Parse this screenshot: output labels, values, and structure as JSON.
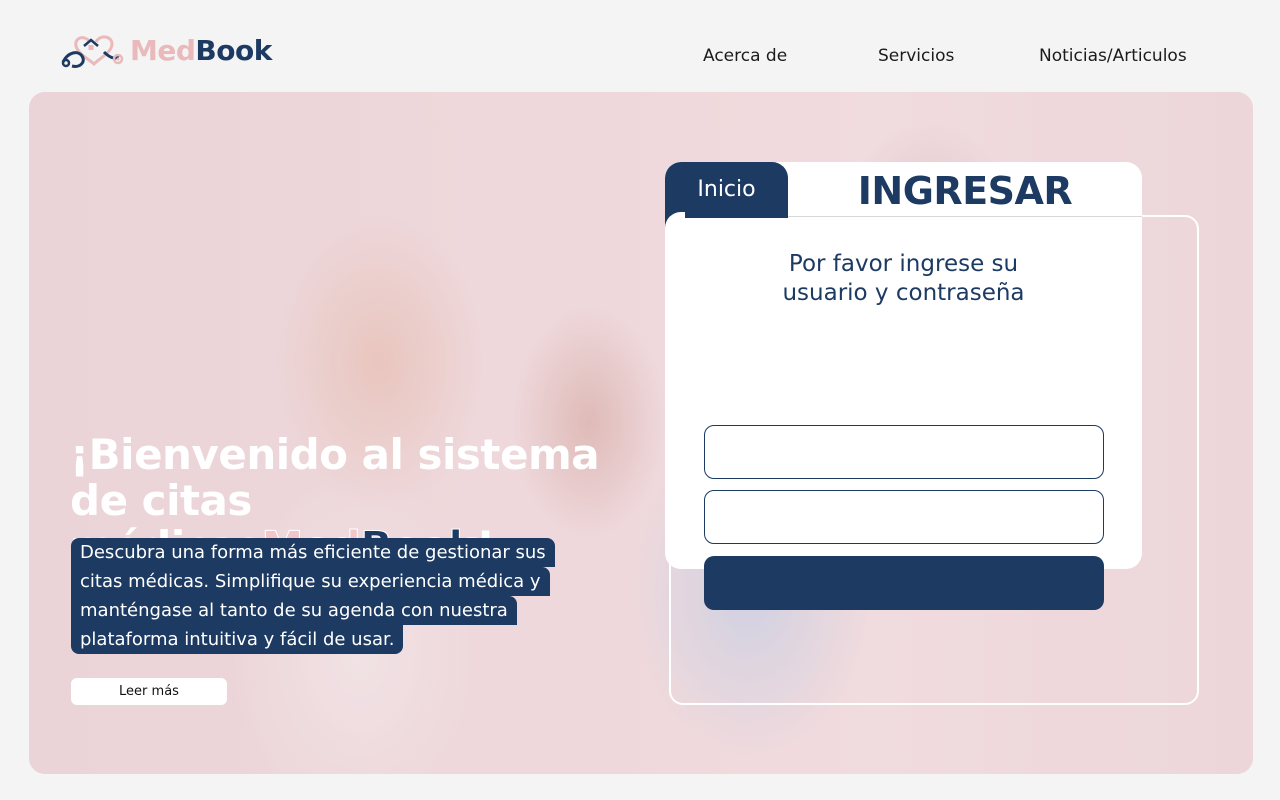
{
  "header": {
    "logo": {
      "text_med": "Med",
      "text_book": "Book",
      "icon": "stethoscope-heart-icon"
    },
    "nav": [
      {
        "label": "Acerca de"
      },
      {
        "label": "Servicios"
      },
      {
        "label": "Noticias/Articulos"
      }
    ]
  },
  "hero": {
    "title_line1": "¡Bienvenido al sistema",
    "title_line2": "de citas médicas",
    "title_brand_med": "Med",
    "title_brand_book": "Book",
    "title_end": "!",
    "description_lines": [
      "Descubra una forma más eficiente de gestionar sus",
      "citas médicas.  Simplifique su experiencia médica y",
      "manténgase al tanto de su agenda con nuestra",
      "plataforma intuitiva y fácil de usar."
    ],
    "read_more_label": "Leer más"
  },
  "login": {
    "tab_label": "Inicio",
    "title": "INGRESAR",
    "instructions_line1": "Por favor ingrese su",
    "instructions_line2": "usuario y contraseña",
    "username_value": "",
    "password_value": "",
    "submit_label": ""
  },
  "colors": {
    "brand_navy": "#1d3a63",
    "brand_pink": "#e9b9bb",
    "page_bg": "#f4f4f4"
  }
}
